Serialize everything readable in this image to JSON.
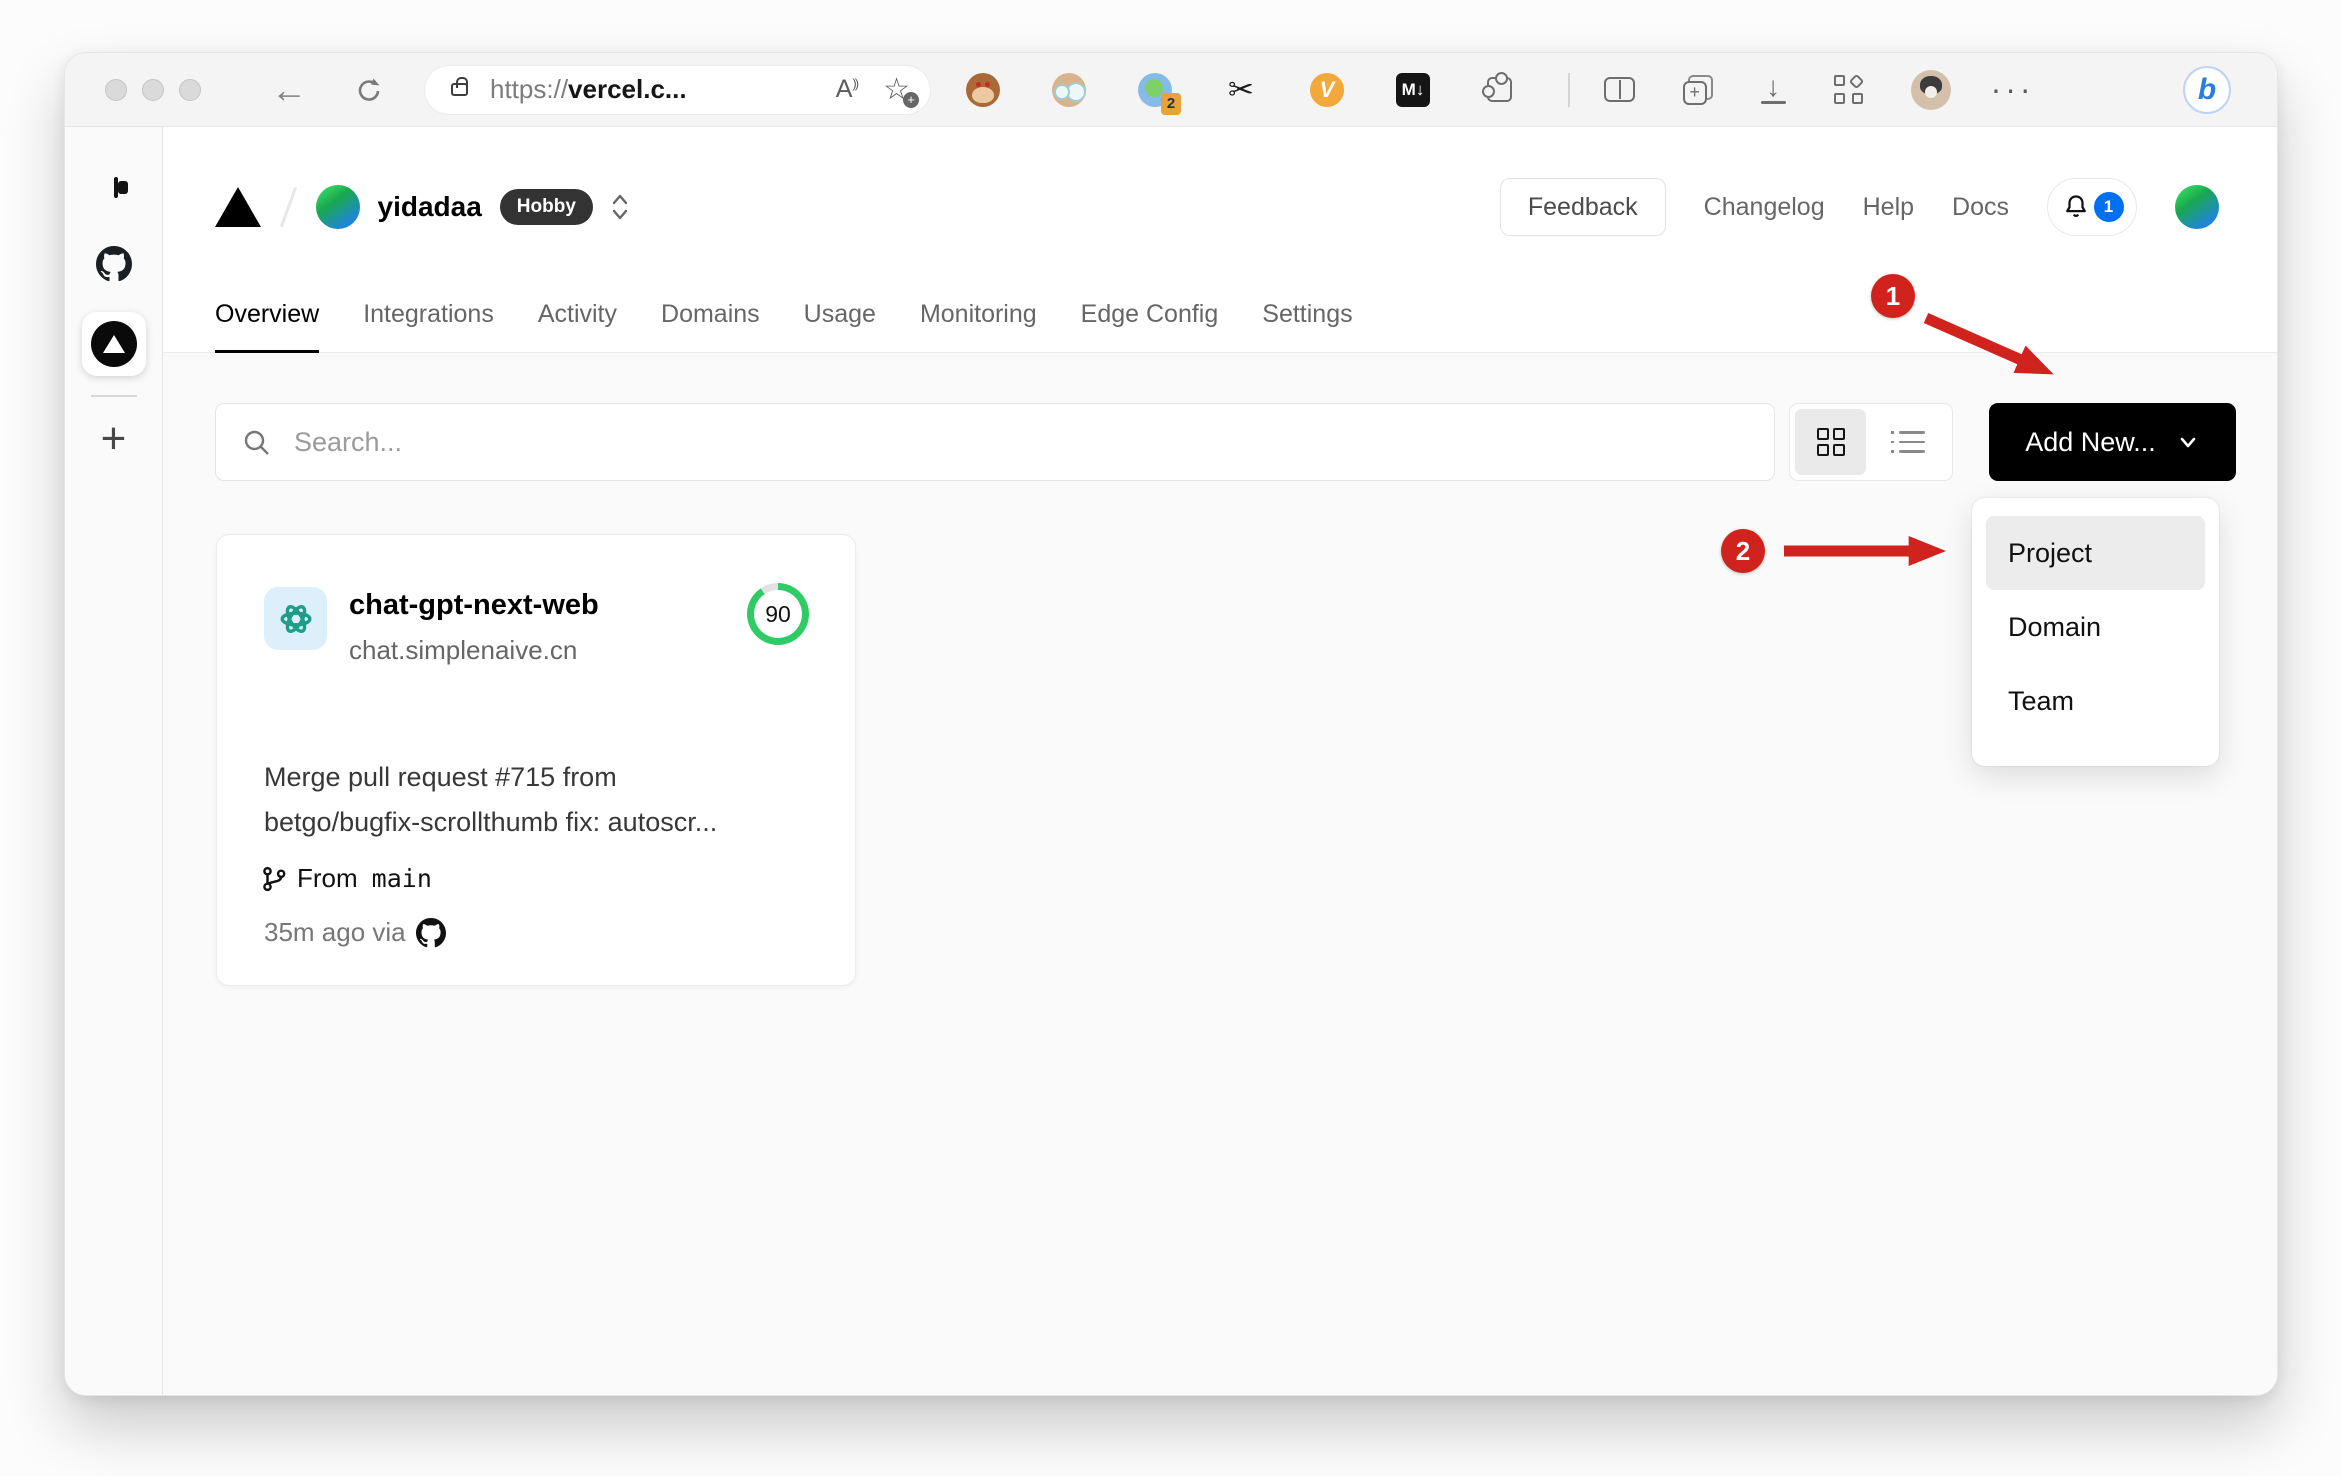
{
  "browser": {
    "url_prefix": "https://",
    "url_host": "vercel.c...",
    "read_aloud_label": "A",
    "extension_badge": "2",
    "markdown_icon_label": "M↓",
    "video_icon_label": "V",
    "more_label": "···",
    "copilot_label": "b",
    "download_glyph": "↓",
    "back_glyph": "←",
    "star_glyph": "☆",
    "scissors_glyph": "✂",
    "collections_plus": "+"
  },
  "edge_sidebar": {
    "add_label": "+"
  },
  "site_header": {
    "team_name": "yidadaa",
    "plan_badge": "Hobby",
    "feedback_label": "Feedback",
    "links": [
      "Changelog",
      "Help",
      "Docs"
    ],
    "notification_count": "1"
  },
  "tabs": [
    {
      "label": "Overview",
      "active": true
    },
    {
      "label": "Integrations",
      "active": false
    },
    {
      "label": "Activity",
      "active": false
    },
    {
      "label": "Domains",
      "active": false
    },
    {
      "label": "Usage",
      "active": false
    },
    {
      "label": "Monitoring",
      "active": false
    },
    {
      "label": "Edge Config",
      "active": false
    },
    {
      "label": "Settings",
      "active": false
    }
  ],
  "toolbar": {
    "search_placeholder": "Search...",
    "add_new_label": "Add New..."
  },
  "project_card": {
    "name": "chat-gpt-next-web",
    "domain": "chat.simplenaive.cn",
    "score": "90",
    "commit_line1": "Merge pull request #715 from",
    "commit_line2": "betgo/bugfix-scrollthumb fix: autoscr...",
    "from_label": "From",
    "branch": "main",
    "deployed": "35m ago via"
  },
  "dropdown": {
    "items": [
      "Project",
      "Domain",
      "Team"
    ]
  },
  "annotations": {
    "step1": "1",
    "step2": "2"
  },
  "colors": {
    "annotation_red": "#d0231d",
    "score_green": "#2fcc66",
    "notification_blue": "#0070f3"
  }
}
